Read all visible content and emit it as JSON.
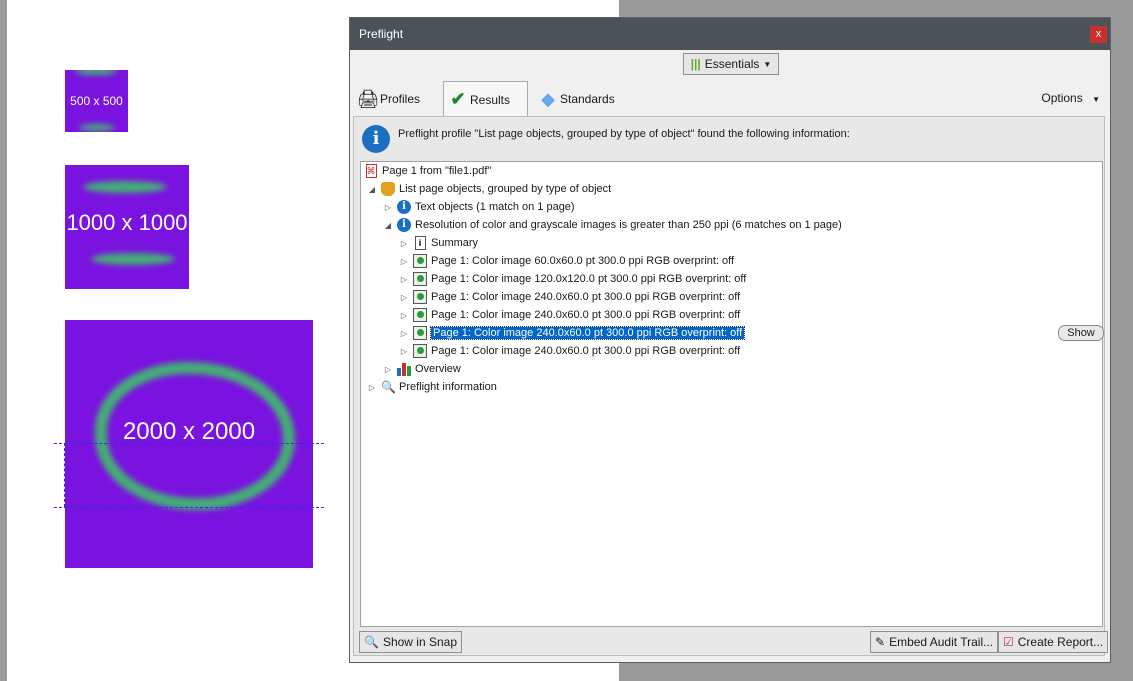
{
  "canvas": {
    "thumb_small_label": "500 x 500",
    "thumb_medium_label": "1000 x 1000",
    "thumb_large_label": "2000 x 2000"
  },
  "dialog": {
    "title": "Preflight",
    "close_label": "x",
    "essentials_label": "Essentials",
    "tabs": {
      "profiles": "Profiles",
      "results": "Results",
      "standards": "Standards"
    },
    "options_label": "Options",
    "info_text": "Preflight profile \"List page objects, grouped by type of object\" found the following information:",
    "tree": {
      "page_root": "Page 1 from \"file1.pdf\"",
      "group": "List page objects, grouped by type of object",
      "text_objects": "Text objects (1 match on 1 page)",
      "resolution": "Resolution of color and grayscale images is greater than 250 ppi (6 matches on 1 page)",
      "summary": "Summary",
      "images": [
        "Page 1: Color image 60.0x60.0 pt 300.0 ppi RGB  overprint: off",
        "Page 1: Color image 120.0x120.0 pt 300.0 ppi RGB  overprint: off",
        "Page 1: Color image 240.0x60.0 pt 300.0 ppi RGB  overprint: off",
        "Page 1: Color image 240.0x60.0 pt 300.0 ppi RGB  overprint: off",
        "Page 1: Color image 240.0x60.0 pt 300.0 ppi RGB  overprint: off",
        "Page 1: Color image 240.0x60.0 pt 300.0 ppi RGB  overprint: off"
      ],
      "overview": "Overview",
      "preflight_info": "Preflight information"
    },
    "show_label": "Show",
    "show_in_snap": "Show in Snap",
    "embed_audit": "Embed Audit Trail...",
    "create_report": "Create Report..."
  },
  "colors": {
    "thumb_fill": "#7a12e0",
    "blur_green": "#3fbf6a",
    "selection": "#0066cc",
    "titlebar": "#4b5258",
    "close_red": "#c9302c"
  }
}
